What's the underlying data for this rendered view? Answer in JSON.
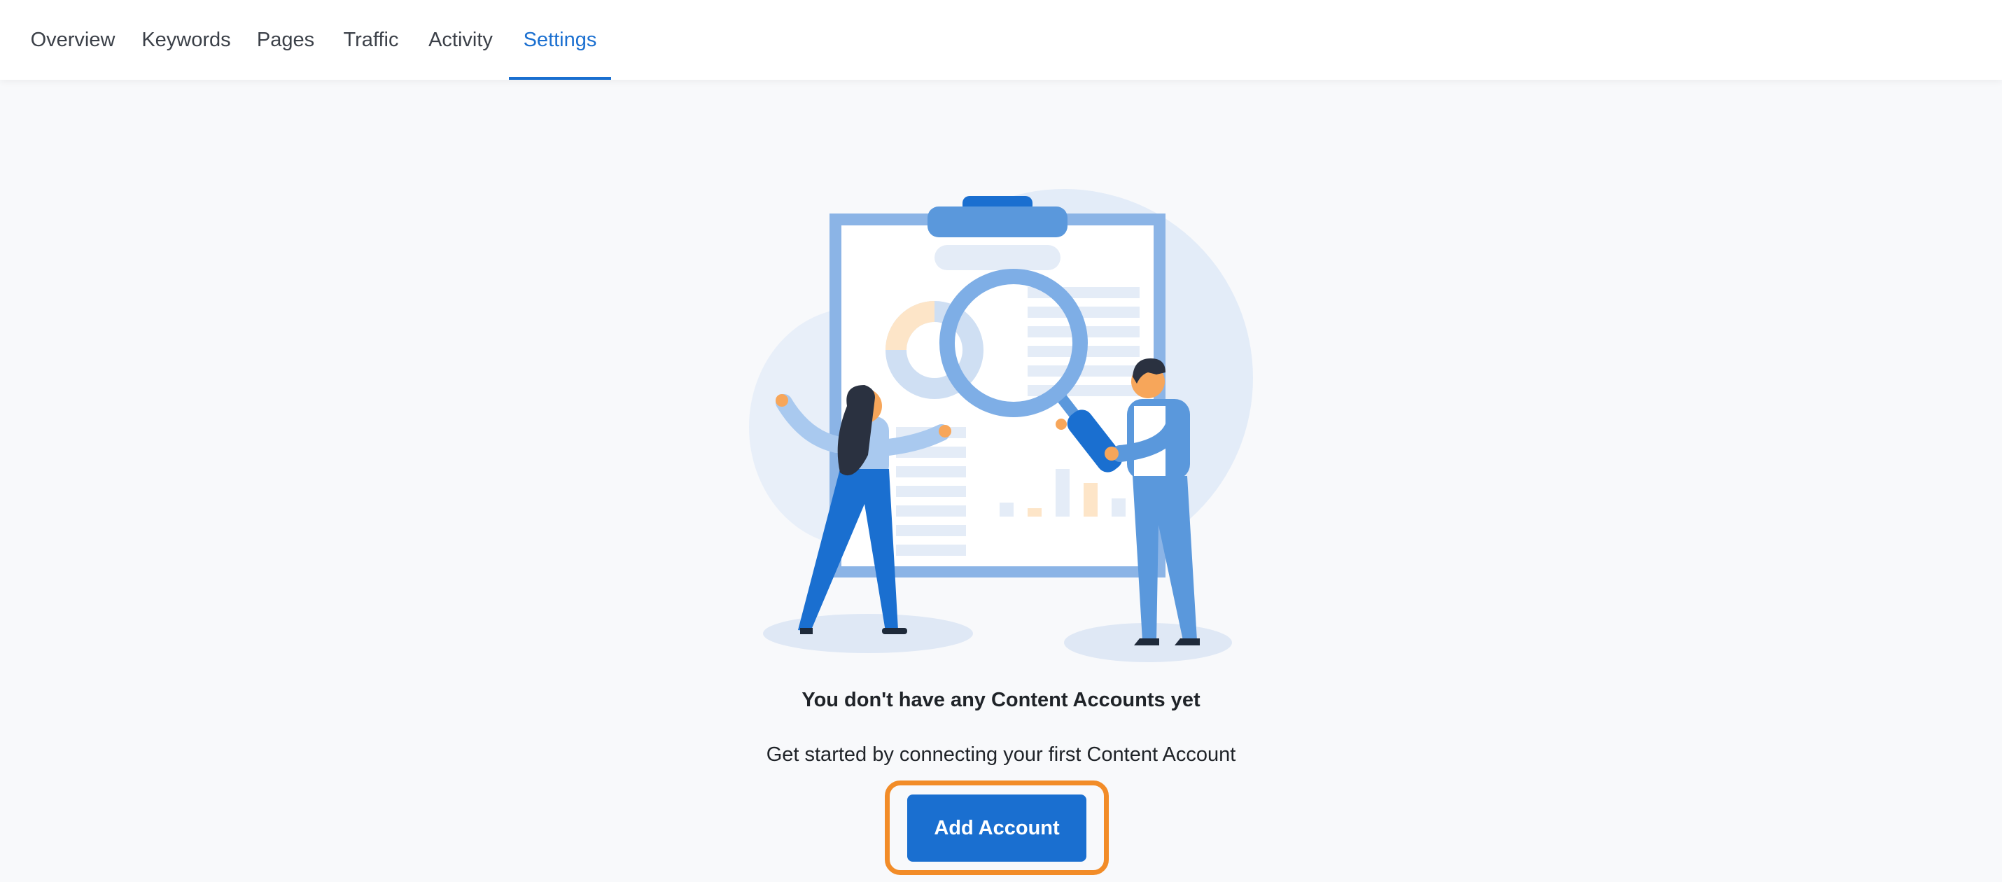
{
  "nav": {
    "tabs": [
      {
        "label": "Overview"
      },
      {
        "label": "Keywords"
      },
      {
        "label": "Pages"
      },
      {
        "label": "Traffic"
      },
      {
        "label": "Activity"
      },
      {
        "label": "Settings"
      }
    ],
    "active_tab": "Settings"
  },
  "empty_state": {
    "title": "You don't have any Content Accounts yet",
    "subtitle": "Get started by connecting your first Content Account",
    "button_label": "Add Account",
    "illustration_icon": "clipboard-search-people-illustration"
  },
  "colors": {
    "accent": "#1a6fd0",
    "highlight": "#f28c28",
    "background": "#f8f9fb"
  }
}
